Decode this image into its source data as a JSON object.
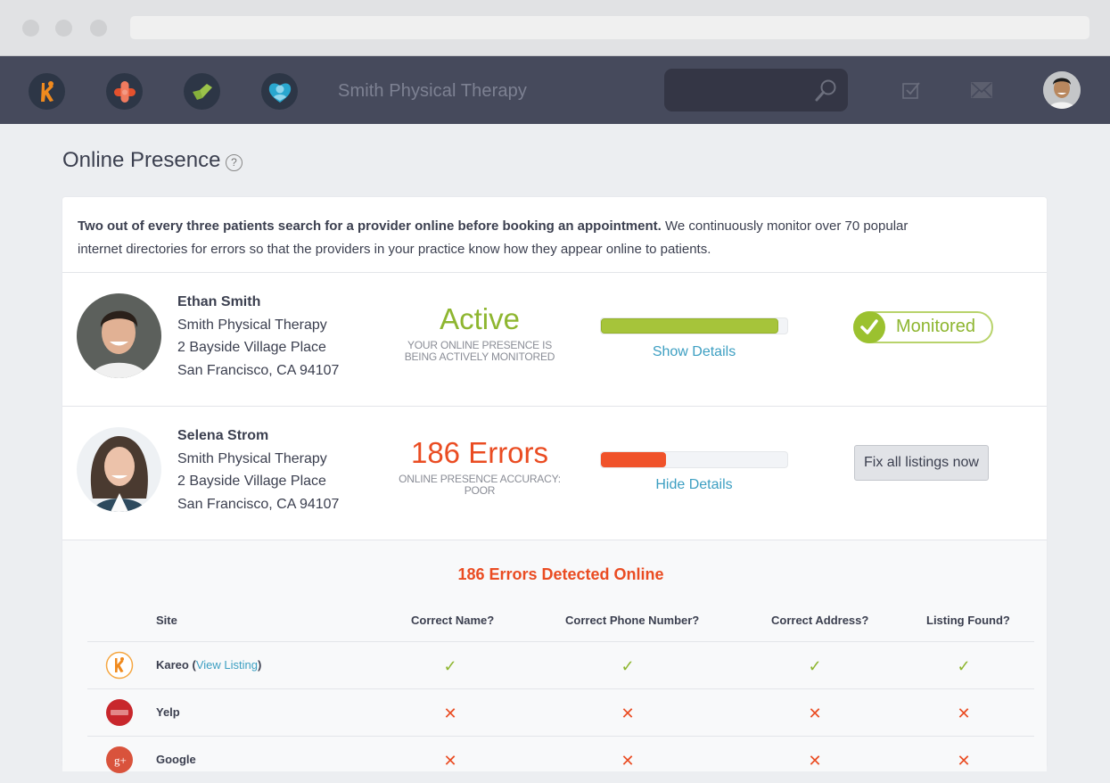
{
  "browser": {
    "window_controls": [
      "close",
      "minimize",
      "maximize"
    ],
    "url": ""
  },
  "nav": {
    "apps": [
      {
        "name": "kareo-app",
        "icon": "kareo-figure-icon",
        "color": "#f08a1e"
      },
      {
        "name": "clinical-app",
        "icon": "bandage-icon",
        "color": "#e95a37"
      },
      {
        "name": "billing-app",
        "icon": "green-check-icon",
        "color": "#7fae36"
      },
      {
        "name": "engage-app",
        "icon": "heart-person-icon",
        "color": "#2aa7cf"
      }
    ],
    "practice_name": "Smith Physical Therapy",
    "search": {
      "value": "",
      "placeholder": ""
    },
    "icons": {
      "tasks": "checkbox-icon",
      "messages": "envelope-icon",
      "user": "user-avatar"
    }
  },
  "page": {
    "title": "Online Presence",
    "help": "?"
  },
  "intro": {
    "bold": "Two out of every three patients search for a provider online before booking an appointment.",
    "text": " We continuously monitor over 70 popular internet directories for errors so that the providers in your practice know how they appear online to patients."
  },
  "providers": [
    {
      "name": "Ethan Smith",
      "practice": "Smith Physical Therapy",
      "address1": "2 Bayside Village Place",
      "address2": "San Francisco, CA 94107",
      "status": "Active",
      "status_sub": "Your online presence is being actively monitored",
      "status_color": "#8eb630",
      "accuracy": 0.95,
      "bar_color": "#a6c43a",
      "details_link": "Show Details",
      "action": "Monitored"
    },
    {
      "name": "Selena Strom",
      "practice": "Smith Physical Therapy",
      "address1": "2 Bayside Village Place",
      "address2": "San Francisco, CA 94107",
      "status": "186 Errors",
      "status_sub": "Online presence accuracy: poor",
      "status_color": "#ea4c22",
      "accuracy": 0.35,
      "bar_color": "#f0522a",
      "details_link": "Hide Details",
      "action": "Fix all listings now"
    }
  ],
  "errors": {
    "title": "186 Errors Detected Online",
    "columns": [
      "Site",
      "Correct Name?",
      "Correct Phone Number?",
      "Correct Address?",
      "Listing Found?"
    ],
    "rows": [
      {
        "site": "Kareo",
        "link": "View Listing",
        "logo": "kareo-logo-icon",
        "checks": [
          true,
          true,
          true,
          true
        ]
      },
      {
        "site": "Yelp",
        "link": "",
        "logo": "yelp-logo-icon",
        "checks": [
          false,
          false,
          false,
          false
        ]
      },
      {
        "site": "Google",
        "link": "",
        "logo": "google-plus-logo-icon",
        "checks": [
          false,
          false,
          false,
          false
        ]
      }
    ]
  }
}
